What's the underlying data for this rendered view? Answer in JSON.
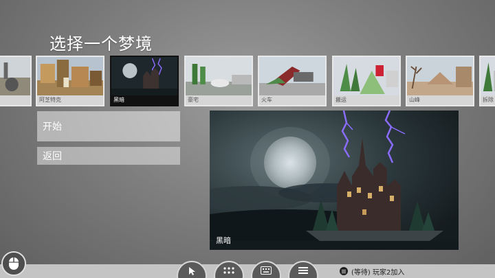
{
  "page_title": "选择一个梦境",
  "levels": [
    {
      "label": ""
    },
    {
      "label": "阿芝特克"
    },
    {
      "label": "黑暗"
    },
    {
      "label": "豪宅"
    },
    {
      "label": "火车"
    },
    {
      "label": "搬运"
    },
    {
      "label": "山峰"
    },
    {
      "label": "拆除"
    }
  ],
  "selected_level": "黑暗",
  "menu": {
    "start_label": "开始",
    "back_label": "返回"
  },
  "preview": {
    "caption": "黑暗"
  },
  "status": {
    "text": "(等待)  玩家2加入"
  },
  "toolbar": {
    "buttons": [
      {
        "icon": "cursor-icon"
      },
      {
        "icon": "keypad-icon"
      },
      {
        "icon": "keyboard-icon"
      },
      {
        "icon": "menu-icon"
      }
    ]
  },
  "colors": {
    "accent_selected": "#111111",
    "background": "#8a8a8a",
    "bottom_bar": "#c4c4c4"
  }
}
